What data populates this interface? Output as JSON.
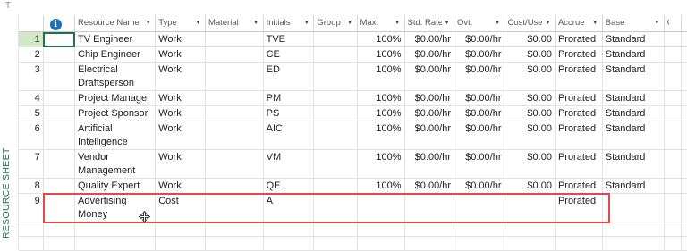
{
  "sidebar": {
    "label": "RESOURCE SHEET"
  },
  "topstub": "T",
  "columns": [
    {
      "key": "indicator",
      "label": "",
      "icon": "info-icon"
    },
    {
      "key": "name",
      "label": "Resource Name"
    },
    {
      "key": "type",
      "label": "Type"
    },
    {
      "key": "material",
      "label": "Material"
    },
    {
      "key": "initials",
      "label": "Initials"
    },
    {
      "key": "group",
      "label": "Group"
    },
    {
      "key": "max",
      "label": "Max."
    },
    {
      "key": "std",
      "label": "Std. Rate"
    },
    {
      "key": "ovt",
      "label": "Ovt."
    },
    {
      "key": "cost",
      "label": "Cost/Use"
    },
    {
      "key": "accrue",
      "label": "Accrue"
    },
    {
      "key": "base",
      "label": "Base"
    },
    {
      "key": "code",
      "label": "Co"
    }
  ],
  "rows": [
    {
      "id": "1",
      "name": "TV Engineer",
      "type": "Work",
      "material": "",
      "initials": "TVE",
      "group": "",
      "max": "100%",
      "std": "$0.00/hr",
      "ovt": "$0.00/hr",
      "cost": "$0.00",
      "accrue": "Prorated",
      "base": "Standard",
      "selected": true
    },
    {
      "id": "2",
      "name": "Chip Engineer",
      "type": "Work",
      "material": "",
      "initials": "CE",
      "group": "",
      "max": "100%",
      "std": "$0.00/hr",
      "ovt": "$0.00/hr",
      "cost": "$0.00",
      "accrue": "Prorated",
      "base": "Standard"
    },
    {
      "id": "3",
      "name": "Electrical Draftsperson",
      "type": "Work",
      "material": "",
      "initials": "ED",
      "group": "",
      "max": "100%",
      "std": "$0.00/hr",
      "ovt": "$0.00/hr",
      "cost": "$0.00",
      "accrue": "Prorated",
      "base": "Standard"
    },
    {
      "id": "4",
      "name": "Project Manager",
      "type": "Work",
      "material": "",
      "initials": "PM",
      "group": "",
      "max": "100%",
      "std": "$0.00/hr",
      "ovt": "$0.00/hr",
      "cost": "$0.00",
      "accrue": "Prorated",
      "base": "Standard"
    },
    {
      "id": "5",
      "name": "Project Sponsor",
      "type": "Work",
      "material": "",
      "initials": "PS",
      "group": "",
      "max": "100%",
      "std": "$0.00/hr",
      "ovt": "$0.00/hr",
      "cost": "$0.00",
      "accrue": "Prorated",
      "base": "Standard"
    },
    {
      "id": "6",
      "name": "Artificial Intelligence",
      "type": "Work",
      "material": "",
      "initials": "AIC",
      "group": "",
      "max": "100%",
      "std": "$0.00/hr",
      "ovt": "$0.00/hr",
      "cost": "$0.00",
      "accrue": "Prorated",
      "base": "Standard"
    },
    {
      "id": "7",
      "name": "Vendor Management",
      "type": "Work",
      "material": "",
      "initials": "VM",
      "group": "",
      "max": "100%",
      "std": "$0.00/hr",
      "ovt": "$0.00/hr",
      "cost": "$0.00",
      "accrue": "Prorated",
      "base": "Standard"
    },
    {
      "id": "8",
      "name": "Quality Expert",
      "type": "Work",
      "material": "",
      "initials": "QE",
      "group": "",
      "max": "100%",
      "std": "$0.00/hr",
      "ovt": "$0.00/hr",
      "cost": "$0.00",
      "accrue": "Prorated",
      "base": "Standard"
    },
    {
      "id": "9",
      "name": "Advertising Money",
      "type": "Cost",
      "material": "",
      "initials": "A",
      "group": "",
      "max": "",
      "std": "",
      "ovt": "",
      "cost": "",
      "accrue": "Prorated",
      "base": ""
    }
  ],
  "colors": {
    "accent": "#217346",
    "highlight": "#e04a4a",
    "info": "#1f6fb8"
  }
}
